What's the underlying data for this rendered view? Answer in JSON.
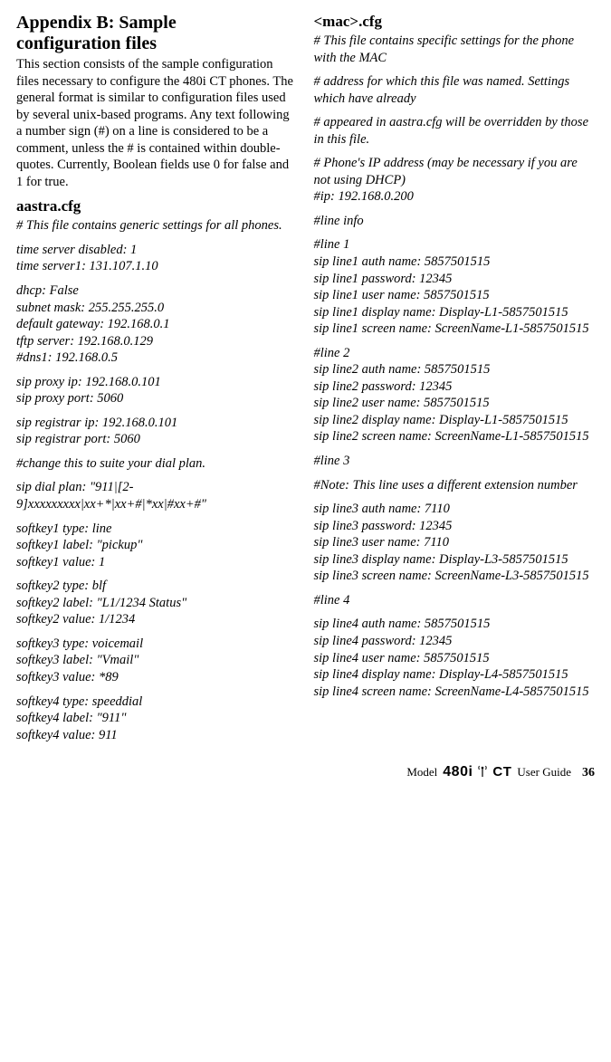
{
  "left": {
    "title_line1": "Appendix B: Sample",
    "title_line2": "configuration files",
    "intro": "This section consists of the sample configuration files necessary to configure the 480i CT phones. The general format is similar to configuration files used by several unix-based programs. Any text following a number sign (#) on a line is considered to be a comment, unless the # is contained within double-quotes. Currently, Boolean fields use 0 for false and 1 for true.",
    "aastra_heading": "aastra.cfg",
    "aastra_note": "# This file contains generic settings for all phones.",
    "time_block": "time server disabled: 1\ntime server1: 131.107.1.10",
    "net_block": "dhcp: False\nsubnet mask: 255.255.255.0\ndefault gateway: 192.168.0.1\ntftp server: 192.168.0.129\n#dns1: 192.168.0.5",
    "proxy_block": "sip proxy ip: 192.168.0.101\nsip proxy port: 5060",
    "registrar_block": "sip registrar ip: 192.168.0.101\nsip registrar port: 5060",
    "dialplan_note": "#change this to suite your dial plan.",
    "dialplan": "sip dial plan: \"911|[2-9]xxxxxxxxx|xx+*|xx+#|*xx|#xx+#\"",
    "softkey1": "softkey1 type: line\nsoftkey1 label: \"pickup\"\nsoftkey1 value: 1",
    "softkey2": "softkey2 type: blf\nsoftkey2 label: \"L1/1234 Status\"\nsoftkey2 value: 1/1234",
    "softkey3": "softkey3 type: voicemail\nsoftkey3 label: \"Vmail\"\nsoftkey3 value: *89",
    "softkey4": "softkey4 type: speeddial\nsoftkey4 label: \"911\"\nsoftkey4 value: 911"
  },
  "right": {
    "mac_heading": "<mac>.cfg",
    "mac_note1": "# This file contains specific settings for the phone with the MAC",
    "mac_note2": "# address for which this file was named. Settings which have already",
    "mac_note3": "# appeared in aastra.cfg will be overridden by those in this file.",
    "ip_block": "# Phone's IP address (may be necessary if you are not using DHCP)\n#ip: 192.168.0.200",
    "line_info": "#line info",
    "line1": "#line 1\nsip line1 auth name: 5857501515\nsip line1 password: 12345\nsip line1 user name: 5857501515\nsip line1 display name: Display-L1-5857501515\nsip line1 screen name: ScreenName-L1-5857501515",
    "line2": "#line 2\nsip line2 auth name: 5857501515\nsip line2 password: 12345\nsip line2 user name: 5857501515\nsip line2 display name: Display-L1-5857501515\nsip line2 screen name: ScreenName-L1-5857501515",
    "line3_header": "#line 3",
    "line3_note": "#Note: This line uses a different extension number",
    "line3": "sip line3 auth name: 7110\nsip line3 password: 12345\nsip line3 user name: 7110\nsip line3 display name: Display-L3-5857501515\nsip line3 screen name: ScreenName-L3-5857501515",
    "line4_header": "#line 4",
    "line4": "sip line4 auth name: 5857501515\nsip line4 password: 12345\nsip line4 user name: 5857501515\nsip line4 display name: Display-L4-5857501515\nsip line4 screen name: ScreenName-L4-5857501515"
  },
  "footer": {
    "model_prefix": "Model",
    "model_number": "480i",
    "model_suffix": "CT",
    "guide": "User Guide",
    "page": "36"
  }
}
